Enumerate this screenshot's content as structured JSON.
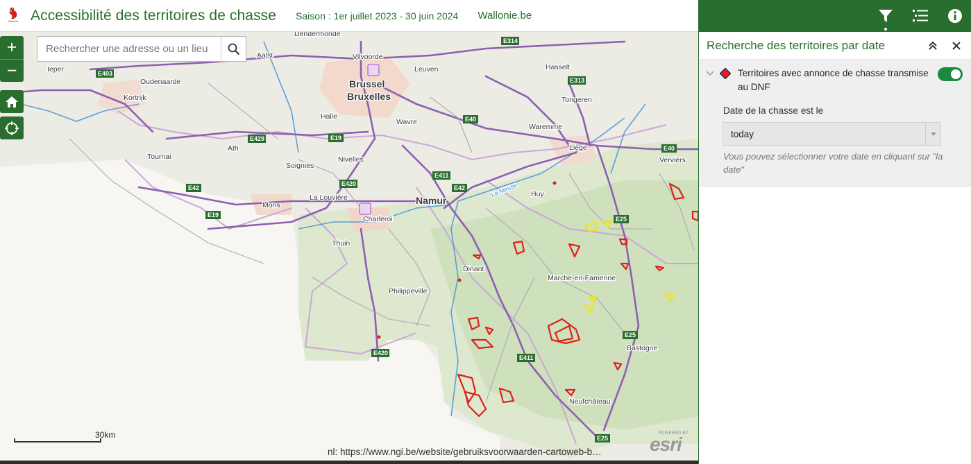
{
  "header": {
    "title": "Accessibilité des territoires de chasse",
    "season": "Saison : 1er juillet 2023 - 30 juin 2024",
    "site": "Wallonie.be",
    "logo_text": "Wallonie"
  },
  "search": {
    "placeholder": "Rechercher une adresse ou un lieu"
  },
  "zoom": {
    "in": "+",
    "out": "−"
  },
  "scale": {
    "label": "30km"
  },
  "attribution": "nl: https://www.ngi.be/website/gebruiksvoorwaarden-cartoweb-b…",
  "esri": {
    "powered": "POWERED BY",
    "logo": "esri"
  },
  "panel": {
    "title": "Recherche des territoires par date",
    "filter_label": "Territoires avec annonce de chasse transmise au DNF",
    "date_label": "Date de la chasse est le",
    "date_value": "today",
    "hint": "Vous pouvez sélectionner votre date en cliquant sur \"la date\""
  },
  "map_labels": {
    "cities": [
      "Dendermonde",
      "Aalst",
      "Vilvoorde",
      "Leuven",
      "Hasselt",
      "Ieper",
      "Oudenaarde",
      "Kortrijk",
      "Brussel",
      "Bruxelles",
      "Tongeren",
      "Wavre",
      "Waremme",
      "Halle",
      "Liège",
      "Verviers",
      "Tournai",
      "Ath",
      "Soignies",
      "Nivelles",
      "Huy",
      "Namur",
      "La Louvière",
      "Mons",
      "Charleroi",
      "Thuin",
      "Dinant",
      "Marche-en-Famenne",
      "Philippeville",
      "Bastogne",
      "Neufchâteau"
    ],
    "roads": [
      "E314",
      "E403",
      "E313",
      "E40",
      "E19",
      "E429",
      "E411",
      "E42",
      "E420",
      "E25"
    ],
    "river": "La Meuse"
  },
  "colors": {
    "brand_green": "#2a6e2f",
    "toggle_on": "#1a8a3f",
    "territory_red": "#e0201b",
    "territory_yellow": "#f2e31a",
    "road_purple": "#8e5fb0",
    "river_blue": "#3a8fd6"
  },
  "icons": {
    "toolbar": [
      "filter-icon",
      "layer-list-icon",
      "info-icon"
    ],
    "controls": [
      "home-icon",
      "locate-icon",
      "search-icon"
    ]
  }
}
